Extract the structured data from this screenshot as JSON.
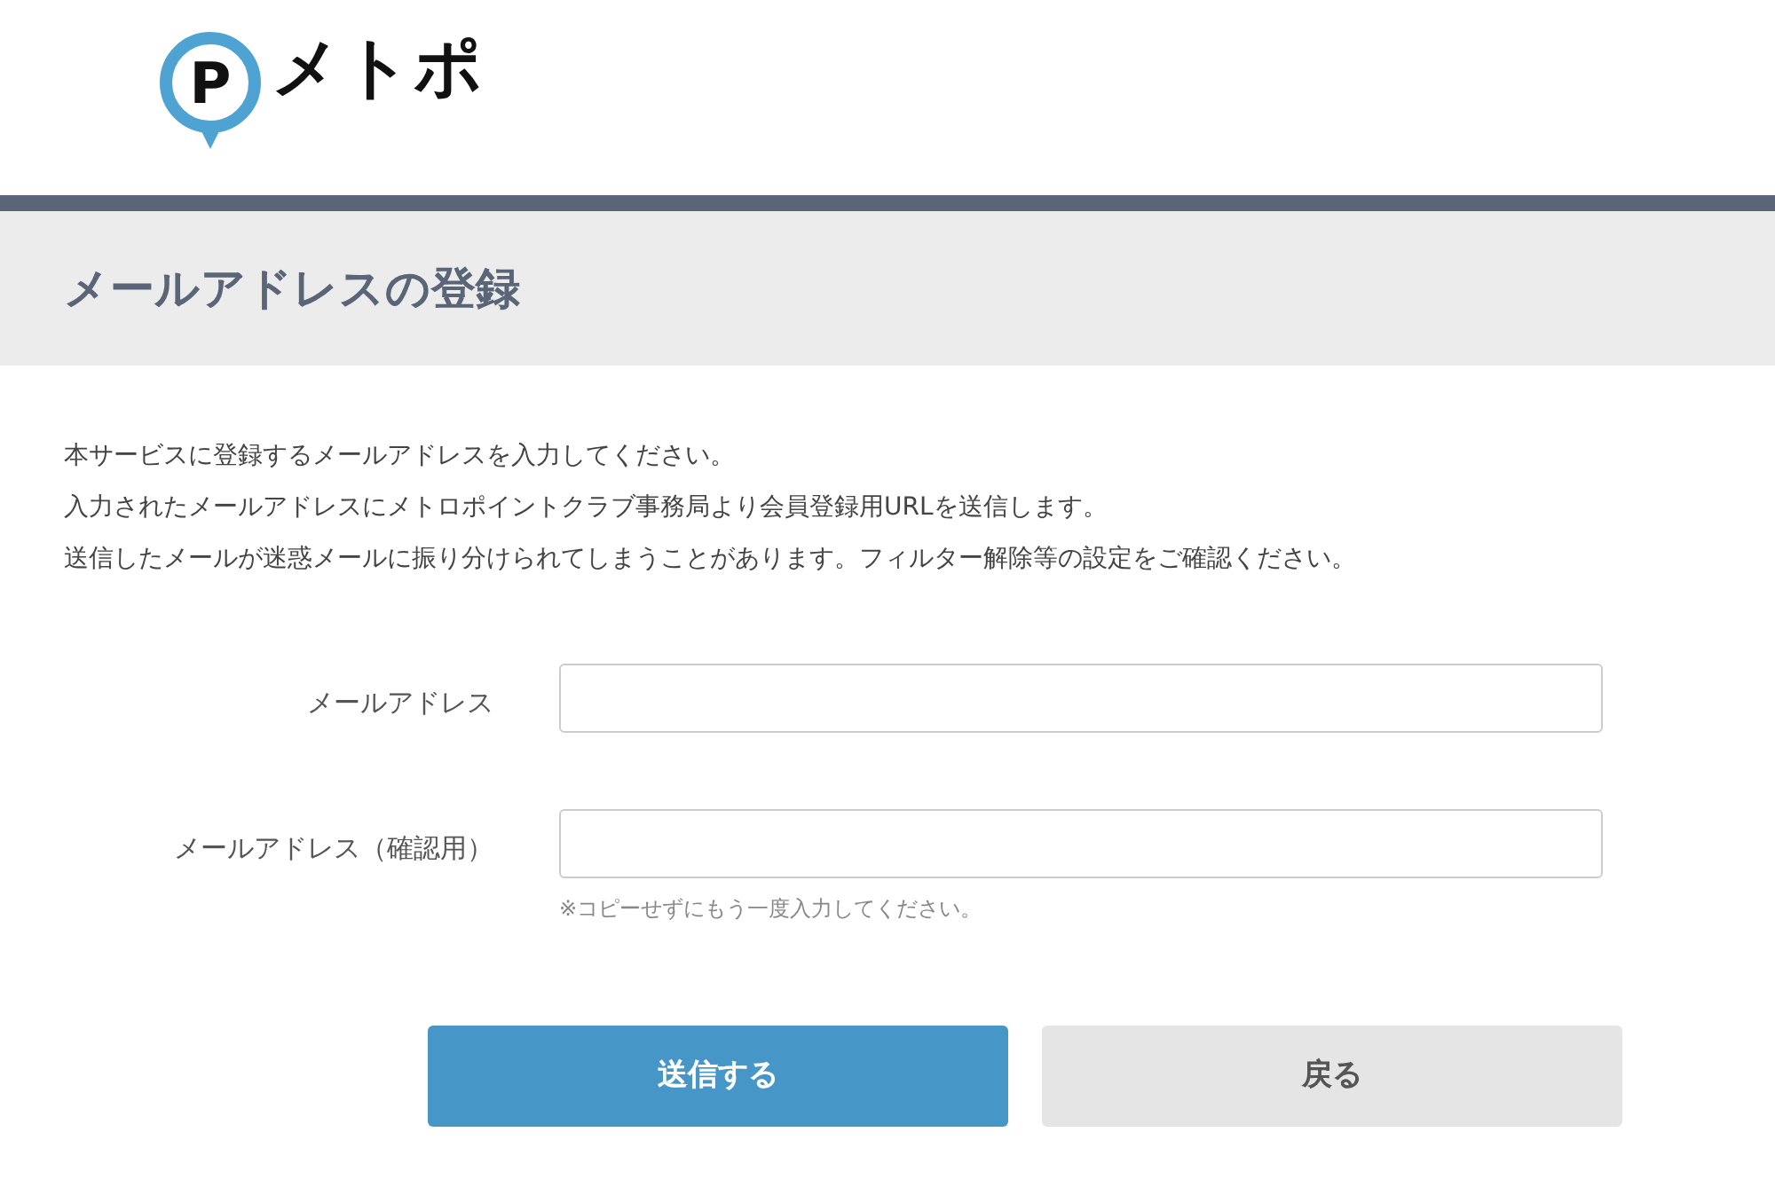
{
  "header": {
    "logo": {
      "mark": "P",
      "name": "メトポ"
    }
  },
  "page_title": "メールアドレスの登録",
  "intro": [
    "本サービスに登録するメールアドレスを入力してください。",
    "入力されたメールアドレスにメトロポイントクラブ事務局より会員登録用URLを送信します。",
    "送信したメールが迷惑メールに振り分けられてしまうことがあります。フィルター解除等の設定をご確認ください。"
  ],
  "form": {
    "fields": [
      {
        "label": "メールアドレス"
      },
      {
        "label": "メールアドレス（確認用）",
        "hint": "※コピーせずにもう一度入力してください。"
      }
    ]
  },
  "buttons": [
    {
      "label": "送信する",
      "kind": "primary"
    },
    {
      "label": "戻る",
      "kind": "secondary"
    }
  ]
}
